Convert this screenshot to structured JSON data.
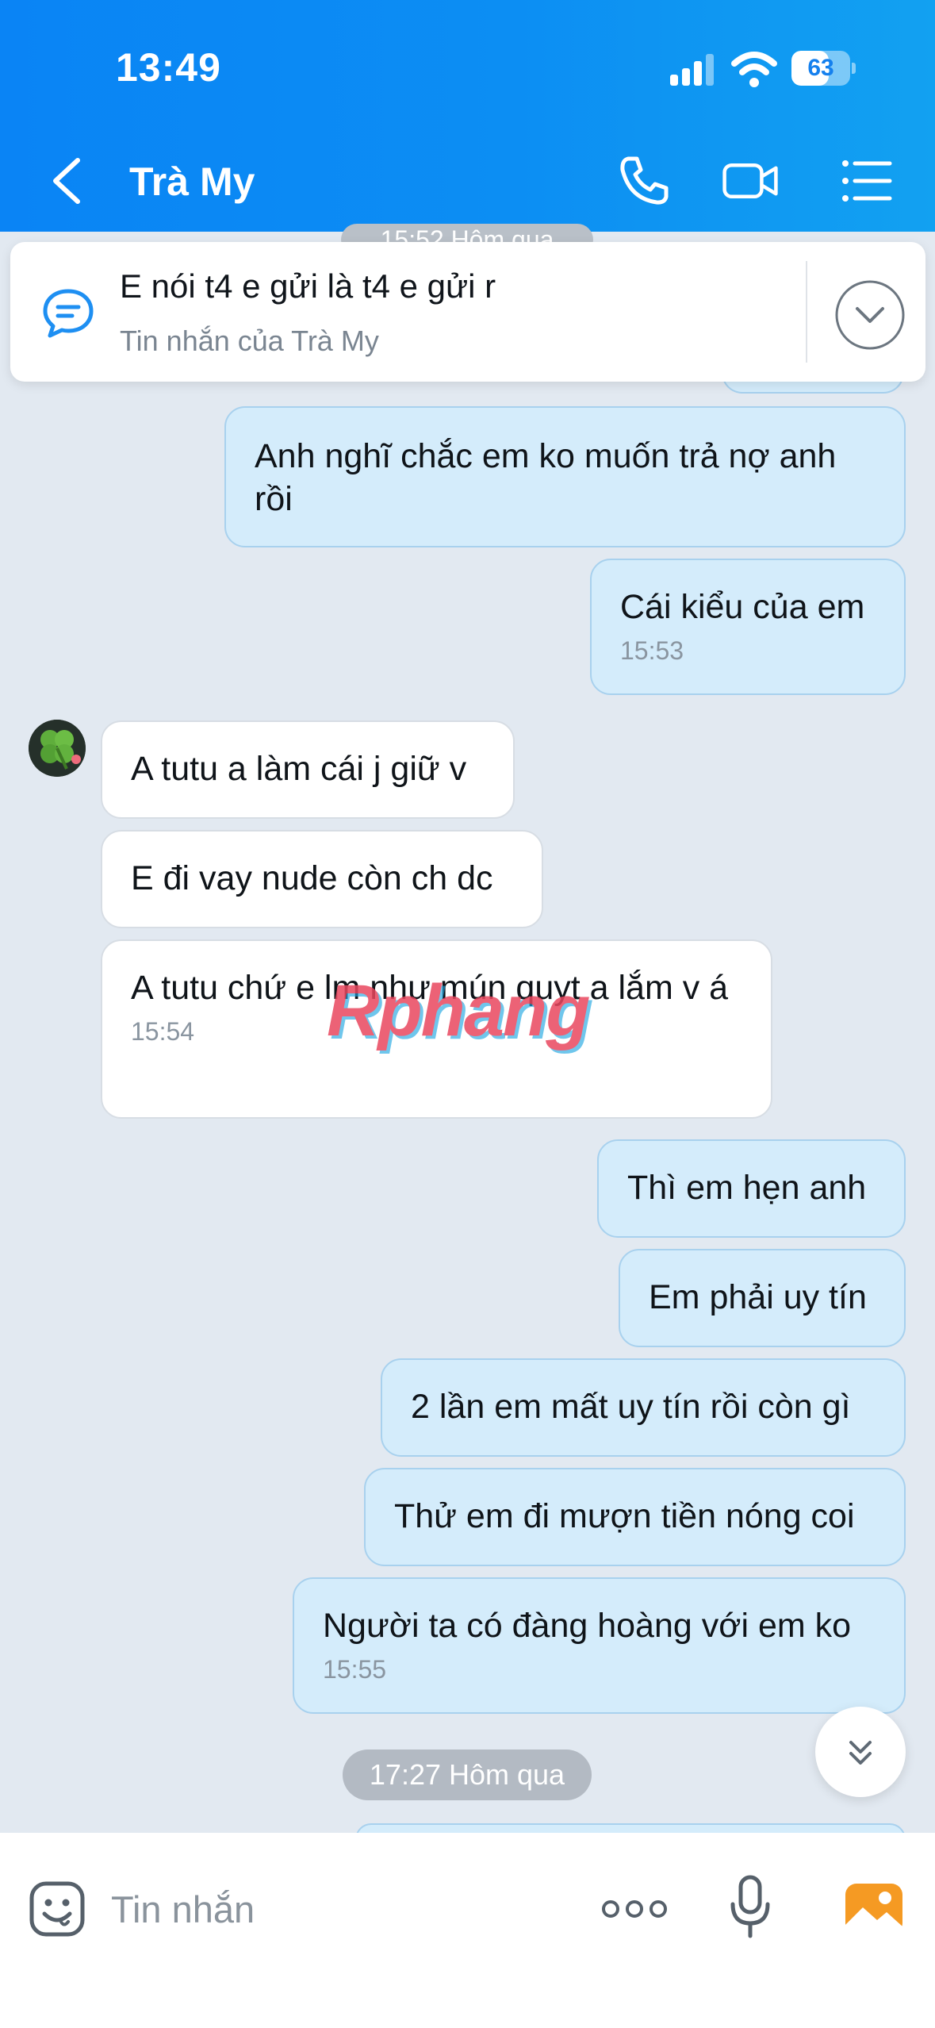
{
  "status_bar": {
    "time": "13:49",
    "battery": "63",
    "battery_level": 0.63
  },
  "header": {
    "title": "Trà My"
  },
  "pinned": {
    "text": "E nói t4 e gửi là t4 e gửi r",
    "subtitle": "Tin nhắn của Trà My",
    "behind_time": "15:52 Hôm qua"
  },
  "messages": [
    {
      "dir": "out",
      "text": "Anh nghĩ chắc em ko muốn trả nợ anh rồi",
      "time": ""
    },
    {
      "dir": "out",
      "text": "Cái kiểu của em",
      "time": "15:53"
    },
    {
      "dir": "in",
      "text": "A tutu a làm cái j giữ v",
      "time": ""
    },
    {
      "dir": "in",
      "text": "E đi vay nude còn ch dc",
      "time": ""
    },
    {
      "dir": "in",
      "text": "A tutu chứ e lm như mún quyt a lắm v á",
      "time": "15:54"
    },
    {
      "dir": "out",
      "text": "Thì em hẹn anh",
      "time": ""
    },
    {
      "dir": "out",
      "text": "Em phải uy tín",
      "time": ""
    },
    {
      "dir": "out",
      "text": "2 lần em mất uy tín rồi còn gì",
      "time": ""
    },
    {
      "dir": "out",
      "text": "Thử em đi mượn tiền nóng coi",
      "time": ""
    },
    {
      "dir": "out",
      "text": "Người ta có đàng hoàng với em ko",
      "time": "15:55"
    }
  ],
  "date_separator": "17:27 Hôm qua",
  "watermark": "Rphang",
  "composer": {
    "placeholder": "Tin nhắn",
    "value": ""
  },
  "colors": {
    "header": "#0c8ef3",
    "bubble_out": "#d4ecfb",
    "bubble_in": "#ffffff",
    "background": "#e2e9f1"
  }
}
